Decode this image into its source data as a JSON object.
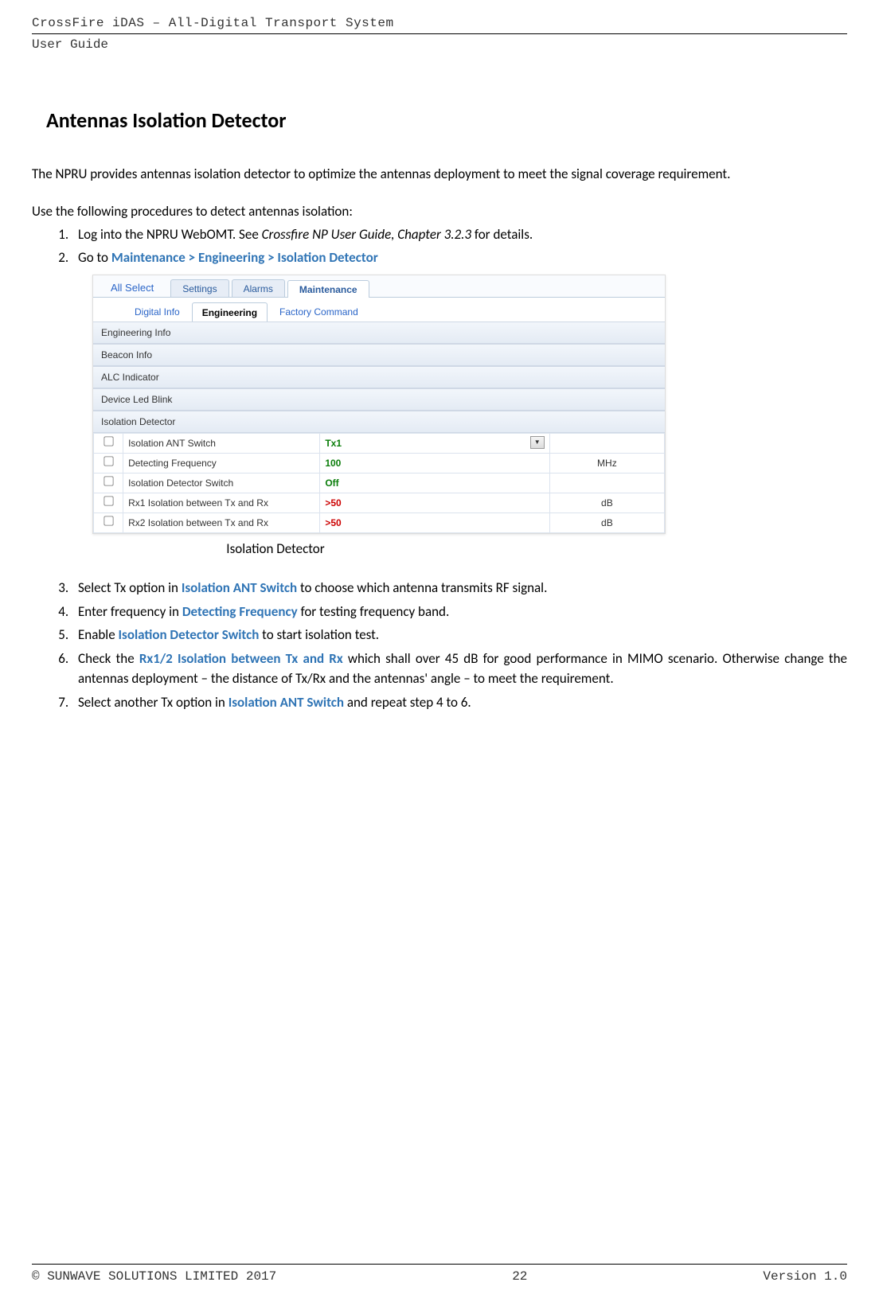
{
  "header": {
    "title": "CrossFire iDAS – All-Digital Transport System",
    "subtitle": "User Guide"
  },
  "section": {
    "heading": "Antennas Isolation Detector",
    "intro": "The NPRU provides antennas isolation detector to optimize the antennas deployment to meet the signal coverage requirement.",
    "procedure_intro": "Use the following procedures to detect antennas isolation:",
    "steps": {
      "s1_a": "Log into the NPRU WebOMT. See ",
      "s1_b": "Crossfire NP User Guide, Chapter 3.2.3",
      "s1_c": " for details.",
      "s2_a": "Go to ",
      "s2_b": "Maintenance > Engineering > Isolation Detector",
      "s3_a": "Select Tx option in ",
      "s3_b": "Isolation ANT Switch",
      "s3_c": " to choose which antenna transmits RF signal.",
      "s4_a": "Enter frequency in ",
      "s4_b": "Detecting Frequency",
      "s4_c": " for testing frequency band.",
      "s5_a": "Enable ",
      "s5_b": "Isolation Detector Switch",
      "s5_c": " to start isolation test.",
      "s6_a": "Check the ",
      "s6_b": "Rx1/2 Isolation between Tx and Rx",
      "s6_c": " which shall over 45 dB for good performance in MIMO scenario. Otherwise change the antennas deployment – the distance of Tx/Rx and the antennas' angle – to meet the requirement.",
      "s7_a": "Select another Tx option in ",
      "s7_b": "Isolation ANT Switch",
      "s7_c": " and repeat step 4 to 6."
    },
    "caption": "Isolation Detector"
  },
  "screenshot": {
    "allselect": "All Select",
    "tabs": {
      "settings": "Settings",
      "alarms": "Alarms",
      "maintenance": "Maintenance"
    },
    "subtabs": {
      "digital_info": "Digital Info",
      "engineering": "Engineering",
      "factory_command": "Factory Command"
    },
    "panels": {
      "engineering_info": "Engineering Info",
      "beacon_info": "Beacon Info",
      "alc_indicator": "ALC Indicator",
      "device_led_blink": "Device Led Blink",
      "isolation_detector": "Isolation Detector"
    },
    "rows": [
      {
        "label": "Isolation ANT Switch",
        "value": "Tx1",
        "unit": "",
        "dropdown": true
      },
      {
        "label": "Detecting Frequency",
        "value": "100",
        "unit": "MHz"
      },
      {
        "label": "Isolation Detector Switch",
        "value": "Off",
        "unit": ""
      },
      {
        "label": "Rx1 Isolation between Tx and Rx",
        "value": ">50",
        "unit": "dB",
        "red": true
      },
      {
        "label": "Rx2 Isolation between Tx and Rx",
        "value": ">50",
        "unit": "dB",
        "red": true
      }
    ]
  },
  "footer": {
    "left": "© SUNWAVE SOLUTIONS LIMITED 2017",
    "center": "22",
    "right": "Version 1.0"
  }
}
